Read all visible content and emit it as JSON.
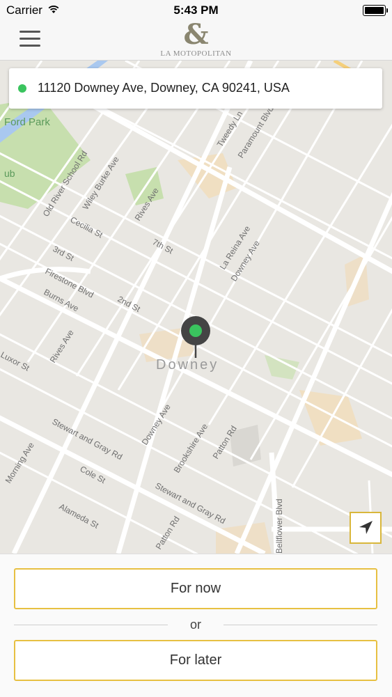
{
  "status_bar": {
    "carrier": "Carrier",
    "time": "5:43 PM"
  },
  "header": {
    "logo_symbol": "&",
    "brand": "LA MOTOPOLITAN"
  },
  "address_bar": {
    "address": "11120 Downey Ave, Downey, CA 90241, USA",
    "status_color": "#3ac45e"
  },
  "map": {
    "city_label": "Downey",
    "streets": [
      "Old River School Rd",
      "Wiley Burke Ave",
      "Rives Ave",
      "Cecilia St",
      "3rd St",
      "7th St",
      "2nd St",
      "Firestone Blvd",
      "Burns Ave",
      "Luxor St",
      "Stewart and Gray Rd",
      "Cole St",
      "Alameda St",
      "Morning Ave",
      "Downey Ave",
      "La Reina Ave",
      "Brookshire Ave",
      "Patton Rd",
      "Paramount Blvd",
      "Tweedy Ln",
      "Bellflower Blvd",
      "Ford Park"
    ],
    "pin_color": "#3ac45e"
  },
  "actions": {
    "now_label": "For now",
    "or_label": "or",
    "later_label": "For later"
  },
  "colors": {
    "accent": "#e7c042"
  }
}
